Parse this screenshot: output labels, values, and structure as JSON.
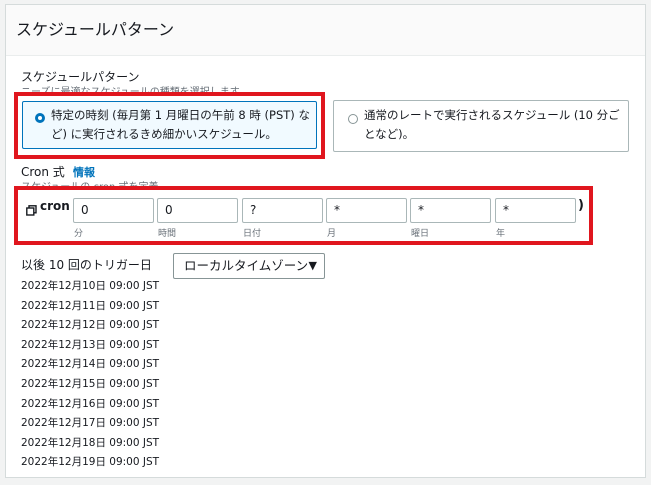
{
  "panel": {
    "title": "スケジュールパターン"
  },
  "pattern": {
    "label": "スケジュールパターン",
    "description": "ニーズに最適なスケジュールの種類を選択します。",
    "options": [
      {
        "line1": "特定の時刻 (毎月第 1 月曜日の午前 8 時 (PST) な",
        "line2": "ど) に実行されるきめ細かいスケジュール。",
        "selected": true
      },
      {
        "line1": "通常のレートで実行されるスケジュール (10 分ご",
        "line2": "となど)。",
        "selected": false
      }
    ]
  },
  "cron": {
    "label": "Cron 式",
    "info": "情報",
    "description": "スケジュールの cron 式を定義",
    "prefix": "cron (",
    "suffix": ")",
    "copy_icon": "copy-icon",
    "fields": [
      {
        "value": "0",
        "caption": "分"
      },
      {
        "value": "0",
        "caption": "時間"
      },
      {
        "value": "?",
        "caption": "日付"
      },
      {
        "value": "*",
        "caption": "月"
      },
      {
        "value": "*",
        "caption": "曜日"
      },
      {
        "value": "*",
        "caption": "年"
      }
    ]
  },
  "triggers": {
    "label": "以後 10 回のトリガー日",
    "timezone": "ローカルタイムゾーン",
    "dates": [
      "2022年12月10日 09:00 JST",
      "2022年12月11日 09:00 JST",
      "2022年12月12日 09:00 JST",
      "2022年12月13日 09:00 JST",
      "2022年12月14日 09:00 JST",
      "2022年12月15日 09:00 JST",
      "2022年12月16日 09:00 JST",
      "2022年12月17日 09:00 JST",
      "2022年12月18日 09:00 JST",
      "2022年12月19日 09:00 JST"
    ]
  },
  "colors": {
    "accent": "#0073bb",
    "highlight": "#e0161e"
  }
}
